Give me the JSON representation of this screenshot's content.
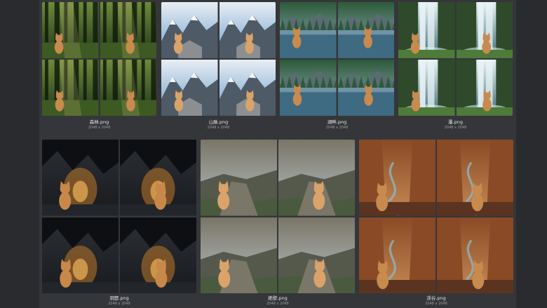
{
  "gallery": {
    "items": [
      {
        "filename": "森林.png",
        "dimensions": "2048 x 2048",
        "theme": "forest"
      },
      {
        "filename": "山脉.png",
        "dimensions": "2048 x 2048",
        "theme": "mountain"
      },
      {
        "filename": "湖畔.png",
        "dimensions": "2048 x 2048",
        "theme": "lake"
      },
      {
        "filename": "瀑.png",
        "dimensions": "2048 x 2048",
        "theme": "waterfall"
      },
      {
        "filename": "洞窟.png",
        "dimensions": "2048 x 2048",
        "theme": "cave"
      },
      {
        "filename": "絶壁.png",
        "dimensions": "2048 x 2048",
        "theme": "cliff"
      },
      {
        "filename": "渓谷.png",
        "dimensions": "2048 x 2048",
        "theme": "canyon"
      }
    ]
  },
  "colors": {
    "forest": [
      "#1f3318",
      "#6f8a3a",
      "#0f1c0c"
    ],
    "mountain": [
      "#6a9ccc",
      "#e8eef4",
      "#4e5a66"
    ],
    "lake": [
      "#9fb7c9",
      "#2d5a3a",
      "#3e6a82"
    ],
    "waterfall": [
      "#3f6a74",
      "#e8f3f5",
      "#2e4a2a"
    ],
    "cave": [
      "#181a1e",
      "#c07a2a",
      "#2c3034"
    ],
    "cliff": [
      "#b8c2c4",
      "#7a7668",
      "#55594c"
    ],
    "canyon": [
      "#c58a54",
      "#8a4a26",
      "#5a3420"
    ]
  }
}
